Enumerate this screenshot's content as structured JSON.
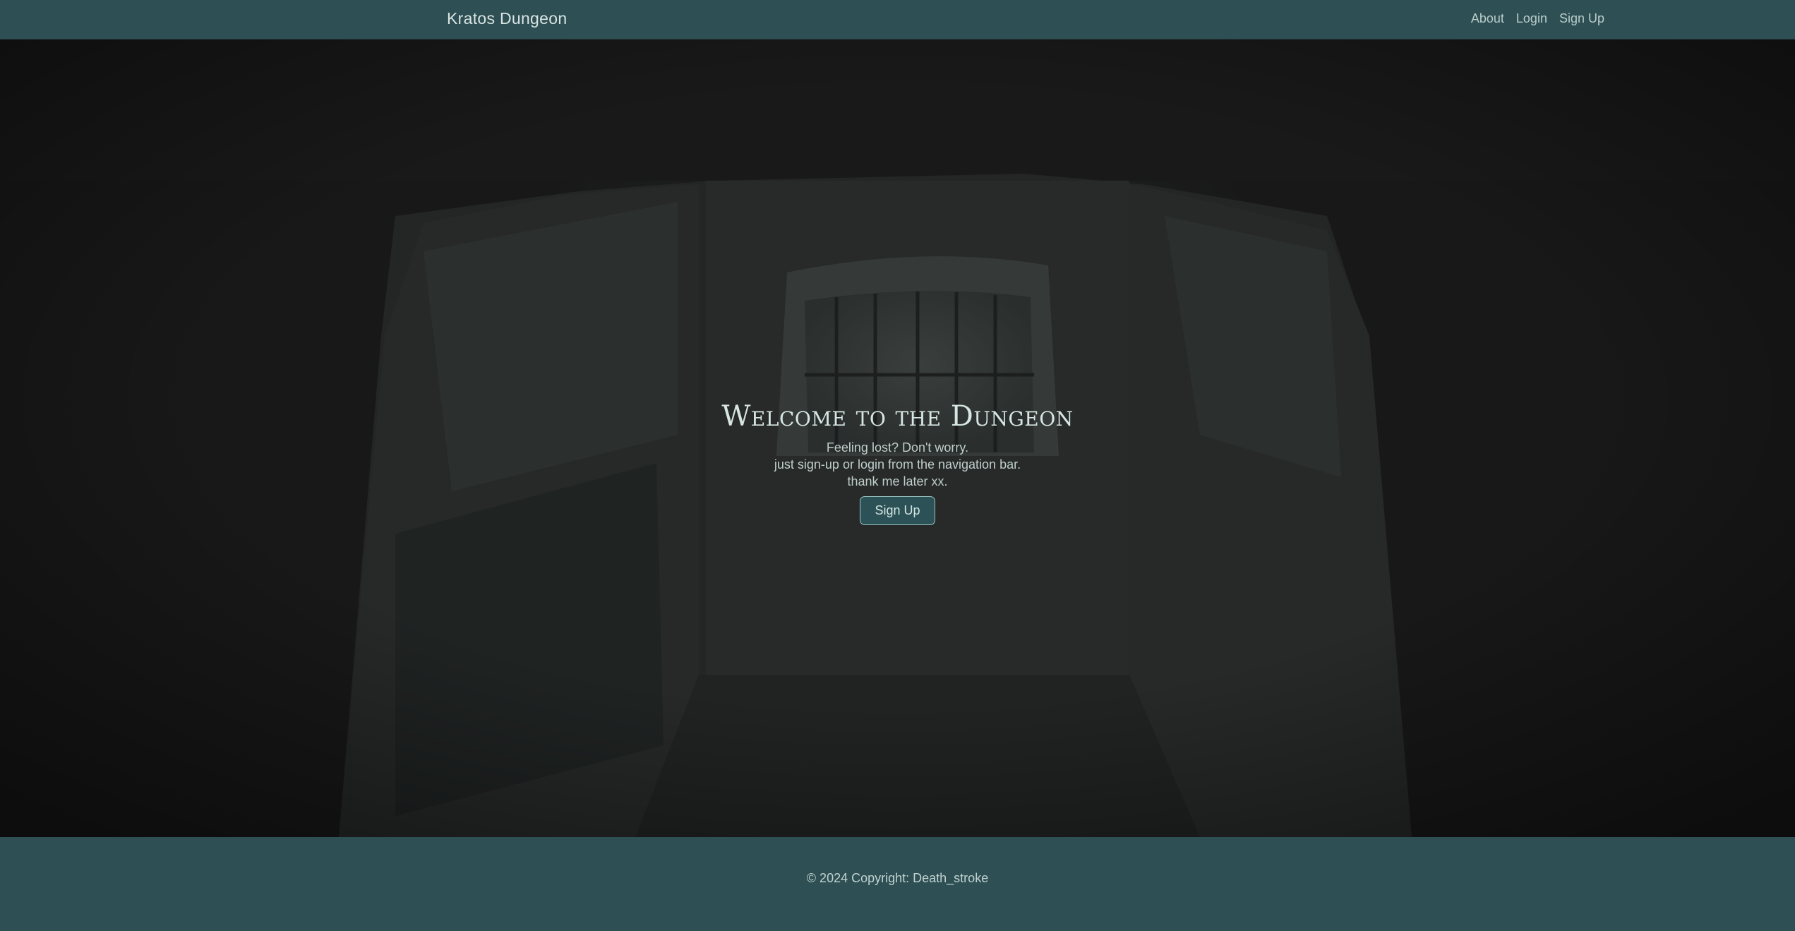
{
  "navbar": {
    "brand": "Kratos Dungeon",
    "links": [
      "About",
      "Login",
      "Sign Up"
    ]
  },
  "hero": {
    "title": "Welcome to the Dungeon",
    "lines": [
      "Feeling lost? Don't worry.",
      "just sign-up or login from the navigation bar.",
      "thank me later xx."
    ],
    "button_label": "Sign Up",
    "background": "dungeon cell with barred window"
  },
  "footer": {
    "copyright": "© 2024 Copyright: Death_stroke"
  },
  "colors": {
    "navbar_bg": "#2e4f53",
    "footer_bg": "#2e4f53",
    "hero_bg": "#1b1b1b",
    "button_bg": "#2c5257",
    "button_border": "#9cc3bf",
    "text_light": "#d7e6e3"
  }
}
